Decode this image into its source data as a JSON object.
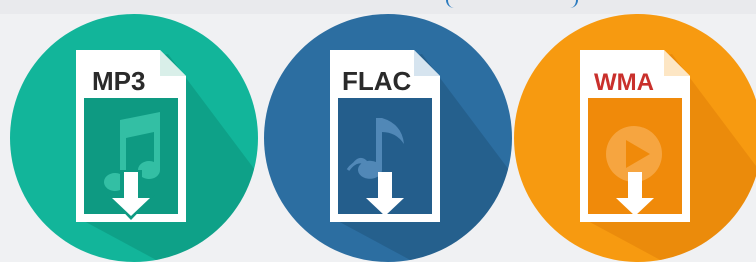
{
  "badges": [
    {
      "label": "MP3",
      "icon": "music-note-icon",
      "circle_color": "#12b59a",
      "doc_color": "#0e9a82",
      "shadow_color": "#0c8a74"
    },
    {
      "label": "FLAC",
      "icon": "music-note-icon",
      "circle_color": "#2c6ea1",
      "doc_color": "#245e8c",
      "shadow_color": "#1e527a"
    },
    {
      "label": "WMA",
      "icon": "play-icon",
      "circle_color": "#f79a10",
      "doc_color": "#f08a0a",
      "shadow_color": "#db7b06"
    }
  ]
}
